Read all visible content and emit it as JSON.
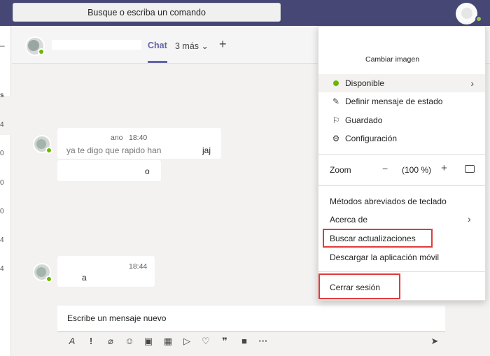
{
  "topbar": {
    "search_placeholder": "Busque o escriba un comando"
  },
  "rail": {
    "numbers": [
      "s",
      "4",
      "0",
      "0",
      "0",
      "4",
      "4"
    ]
  },
  "chat_header": {
    "tab_chat": "Chat",
    "tab_more": "3 más"
  },
  "messages": [
    {
      "sender": "ano",
      "time": "18:40",
      "lines": [
        "ya te digo que rapido han",
        "jaj",
        "o"
      ]
    },
    {
      "sender": "",
      "time": "18:44",
      "lines": [
        "a"
      ]
    }
  ],
  "composer": {
    "placeholder": "Escribe un mensaje nuevo"
  },
  "profile_menu": {
    "change_image": "Cambiar imagen",
    "status": "Disponible",
    "set_status_message": "Definir mensaje de estado",
    "saved": "Guardado",
    "settings": "Configuración",
    "zoom_label": "Zoom",
    "zoom_value": "(100 %)",
    "keyboard_shortcuts": "Métodos abreviados de teclado",
    "about": "Acerca de",
    "check_updates": "Buscar actualizaciones",
    "download_mobile": "Descargar la aplicación móvil",
    "sign_out": "Cerrar sesión"
  },
  "colors": {
    "topbar": "#464775",
    "accent": "#6264a7",
    "available": "#6bb700",
    "highlight_box": "#e03b3b"
  },
  "icons": [
    "search-icon",
    "chevron-down-icon",
    "plus-icon",
    "pencil-icon",
    "bookmark-icon",
    "gear-icon",
    "minus-icon",
    "fit-screen-icon",
    "chevron-right-icon",
    "send-icon"
  ]
}
